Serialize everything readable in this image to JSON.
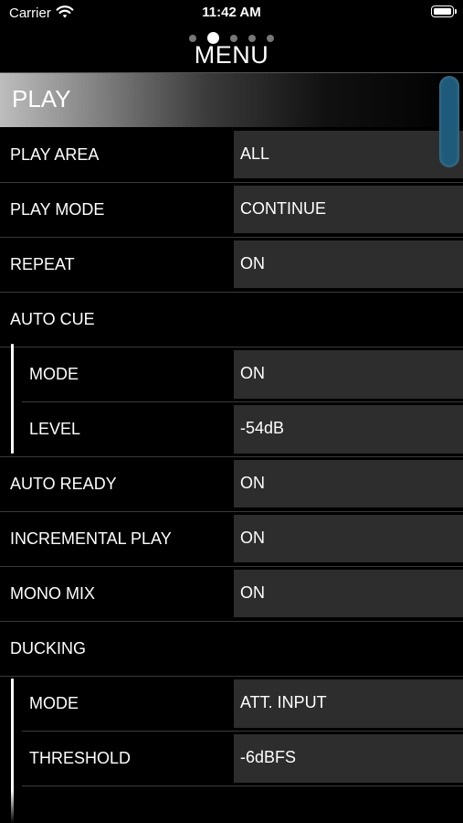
{
  "status_bar": {
    "carrier": "Carrier",
    "time": "11:42 AM",
    "wifi_icon": "wifi-icon",
    "battery_icon": "battery-icon"
  },
  "page_indicator": {
    "count": 5,
    "active_index": 1
  },
  "header": {
    "title": "MENU"
  },
  "section": {
    "title": "PLAY"
  },
  "rows": [
    {
      "label": "PLAY AREA",
      "value": "ALL"
    },
    {
      "label": "PLAY MODE",
      "value": "CONTINUE"
    },
    {
      "label": "REPEAT",
      "value": "ON"
    },
    {
      "label": "AUTO CUE",
      "value": ""
    },
    {
      "label": "MODE",
      "value": "ON"
    },
    {
      "label": "LEVEL",
      "value": "-54dB"
    },
    {
      "label": "AUTO READY",
      "value": "ON"
    },
    {
      "label": "INCREMENTAL PLAY",
      "value": "ON"
    },
    {
      "label": "MONO MIX",
      "value": "ON"
    },
    {
      "label": "DUCKING",
      "value": ""
    },
    {
      "label": "MODE",
      "value": "ATT. INPUT"
    },
    {
      "label": "THRESHOLD",
      "value": "-6dBFS"
    }
  ],
  "colors": {
    "background": "#000000",
    "value_box": "#2d2d2d",
    "scrollbar": "#1e5a7a"
  }
}
